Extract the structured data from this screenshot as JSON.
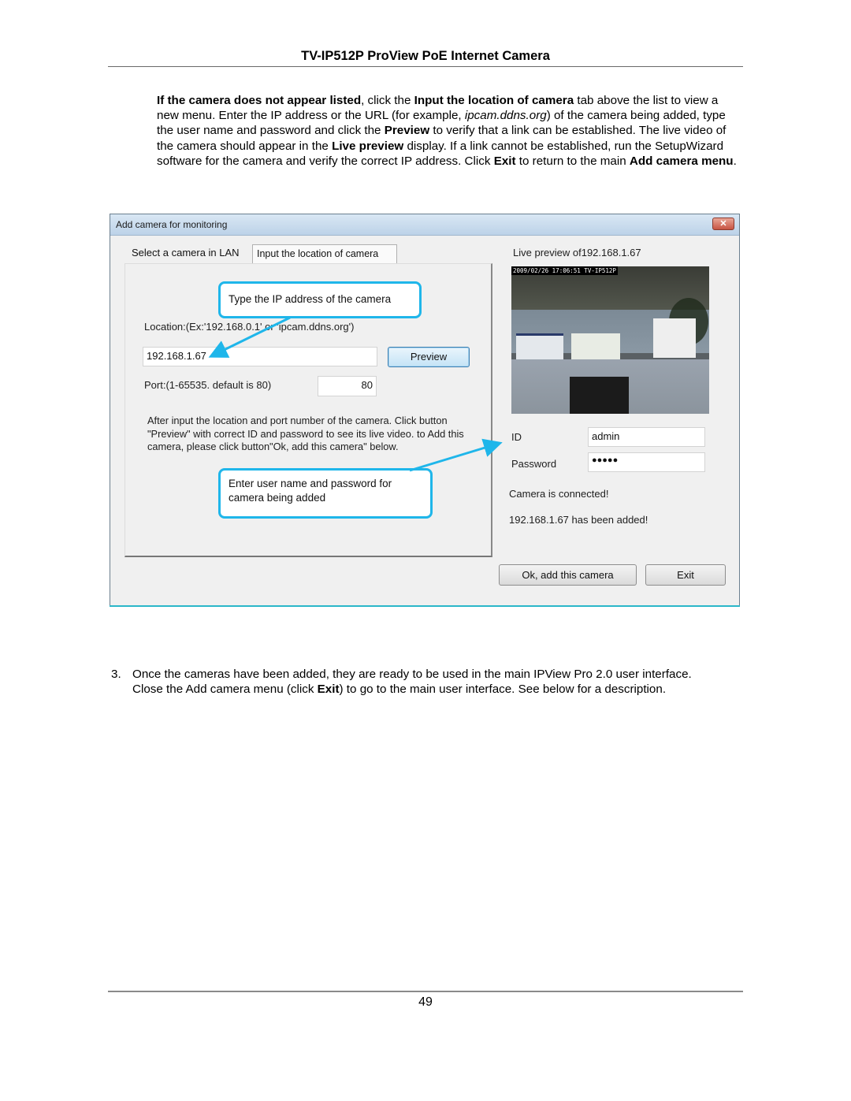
{
  "document": {
    "header_title": "TV-IP512P ProView PoE Internet Camera",
    "intro": {
      "s1_bold": "If the camera does not appear listed",
      "s2": ", click the ",
      "s3_bold": "Input the location of camera",
      "s4": " tab above the list to view a new menu. Enter the IP address or the URL (for example, ",
      "s5_italic": "ipcam.ddns.org",
      "s6": ") of the camera being added, type the user name and password and click the ",
      "s7_bold": "Preview",
      "s8": " to verify that a link can be established. The live video of the camera should appear in the ",
      "s9_bold": "Live preview",
      "s10": " display. If a link cannot be established, run the SetupWizard software for the camera and verify the correct IP address. Click ",
      "s11_bold": "Exit",
      "s12": " to return to the main ",
      "s13_bold": "Add camera menu",
      "s14": "."
    },
    "step3": {
      "number": "3.",
      "t1": "Once the cameras have been added, they are ready to be used in the main IPView Pro 2.0 user interface. Close the Add camera menu (click ",
      "t2_bold": "Exit",
      "t3": ") to go to the main user interface. See below for a description."
    },
    "page_number": "49"
  },
  "dialog": {
    "title": "Add camera for monitoring",
    "close_icon": "close-icon",
    "tabs": [
      {
        "label": "Select a camera in LAN",
        "active": false
      },
      {
        "label": "Input the location of camera",
        "active": true
      }
    ],
    "location_label": "Location:(Ex:'192.168.0.1' or 'ipcam.ddns.org')",
    "location_value": "192.168.1.67",
    "preview_button": "Preview",
    "port_label": "Port:(1-65535. default is 80)",
    "port_value": "80",
    "instructions": "After input the location and port number of the camera. Click button \"Preview\" with correct ID and password to see its live video. to Add this camera, please click button\"Ok, add this camera\" below.",
    "live_preview_label": "Live preview of192.168.1.67",
    "video_osd": "2009/02/26 17:06:51 TV-IP512P",
    "id_label": "ID",
    "id_value": "admin",
    "password_label": "Password",
    "password_value": "●●●●●",
    "status_connected": "Camera is connected!",
    "status_added": "192.168.1.67 has been added!",
    "ok_button": "Ok, add this camera",
    "exit_button": "Exit"
  },
  "callouts": {
    "ip": "Type the IP address of the camera",
    "credentials": "Enter user name and password for camera being added",
    "color": "#1fb6ea"
  }
}
